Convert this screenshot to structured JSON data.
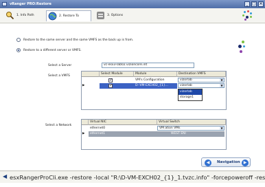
{
  "window": {
    "title": "vRanger PRO:Restore"
  },
  "tabs": [
    {
      "label": "1. Info Path",
      "icon": "magnifier-icon",
      "active": false
    },
    {
      "label": "2. Restore To",
      "icon": "globe-icon",
      "active": true
    },
    {
      "label": "3. Options",
      "icon": "options-icon",
      "active": false
    }
  ],
  "restore": {
    "option_same": "Restore to the same server and the same VMFS as the back up is from.",
    "option_different": "Restore to a different server or VMFS.",
    "selected_option": "different"
  },
  "server": {
    "label": "Select a Server",
    "value": "vc-esx3-lab02.vizioncore.int"
  },
  "vmfs": {
    "label": "Select a VMFS",
    "columns": [
      "Select Module",
      "Module",
      "Destination VMFS"
    ],
    "rows": [
      {
        "checked": true,
        "module": "VM's Configuration",
        "destination": "vizorlab",
        "selected": false
      },
      {
        "checked": true,
        "module": "D--VM-EXCH02_{1}...",
        "destination": "vizorlab",
        "selected": true
      }
    ],
    "dropdown_options": [
      "vizorlab",
      "storage1"
    ],
    "dropdown_selected": "vizorlab"
  },
  "network": {
    "label": "Select a Network",
    "columns": [
      "Virtual NIC",
      "Virtual Switch"
    ],
    "rows": [
      {
        "nic": "ethernet0",
        "switch": "VM ation VMs",
        "selected": false
      },
      {
        "nic": "ethernet1",
        "switch": "WEST ENI",
        "selected": true
      }
    ]
  },
  "navigation": {
    "label": "Navigation"
  },
  "command": {
    "text": "esxRangerProCli.exe -restore -local \"R:\\D-VM-EXCH02_{1}_1.tvzc.info\" -forcepoweroff -restoreconfi..."
  },
  "colors": {
    "accent": "#2f6fd0",
    "selection": "#3c62c4",
    "title_bar": "#4f6ea8"
  }
}
